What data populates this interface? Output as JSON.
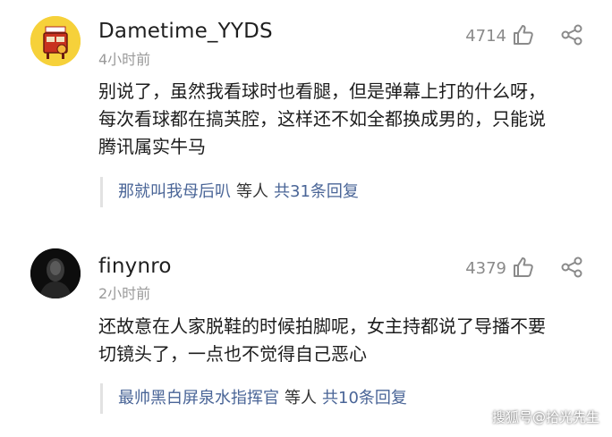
{
  "comments": [
    {
      "username": "Dametime_YYDS",
      "time": "4小时前",
      "likes": "4714",
      "avatar_icon": "cartoon-box-avatar",
      "body_lines": [
        "别说了，虽然我看球时也看腿，但是弹幕上打的什么呀，",
        "每次看球都在搞芵腔，这样还不如全都换成男的，只能说",
        "腾讯属实牛马"
      ],
      "reply": {
        "name": "那就叫我母后叭",
        "mid": "等人",
        "count": "共31条回复"
      }
    },
    {
      "username": "finynro",
      "time": "2小时前",
      "likes": "4379",
      "avatar_icon": "dark-figure-avatar",
      "body_lines": [
        "还故意在人家脱鞋的时候拍脚呢，女主持都说了导播不要",
        "切镜头了，一点也不觉得自己恶心"
      ],
      "reply": {
        "name": "最帅黑白屏泉水指挥官",
        "mid": "等人",
        "count": "共10条回复"
      }
    }
  ],
  "watermark": "搜狐号@拾光先生",
  "colors": {
    "reply_link": "#4a6597",
    "muted": "#9a9a9a",
    "avatar1_bg": "#f6d13a"
  }
}
